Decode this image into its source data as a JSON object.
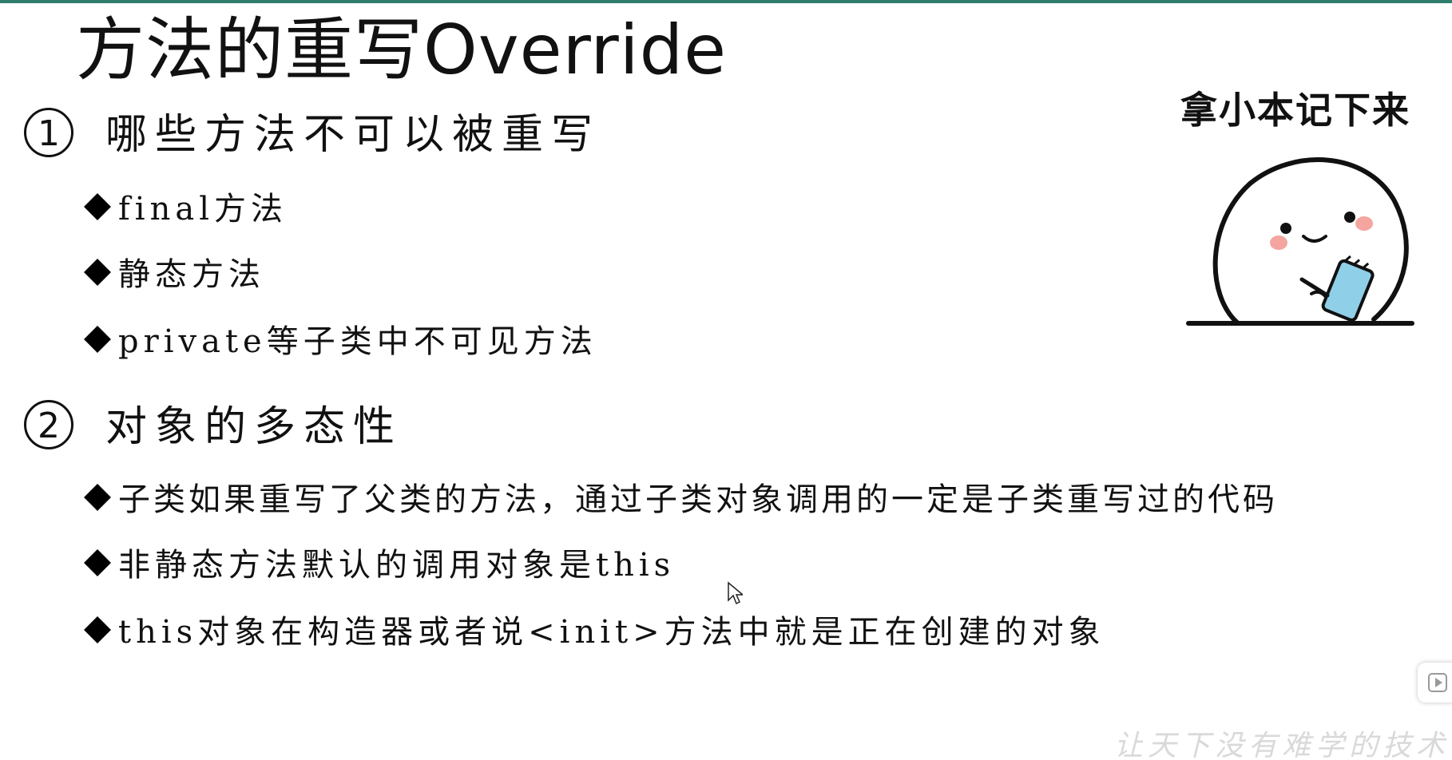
{
  "slide": {
    "title": "方法的重写Override",
    "sections": [
      {
        "number": "1",
        "heading": "哪些方法不可以被重写",
        "bullets": [
          "final方法",
          "静态方法",
          "private等子类中不可见方法"
        ]
      },
      {
        "number": "2",
        "heading": "对象的多态性",
        "bullets": [
          "子类如果重写了父类的方法，通过子类对象调用的一定是子类重写过的代码",
          "非静态方法默认的调用对象是this",
          "this对象在构造器或者说<init>方法中就是正在创建的对象"
        ]
      }
    ],
    "sticker_caption": "拿小本记下来",
    "watermark": "让天下没有难学的技术"
  },
  "colors": {
    "accent_rule": "#2f7d6d",
    "blush": "#f4a5a0",
    "notebook": "#8fcfe8"
  },
  "icons": {
    "bullet": "diamond-bullet-icon",
    "sticker": "cartoon-note-taking-icon",
    "cursor": "mouse-pointer-icon",
    "side_button": "play-icon"
  }
}
